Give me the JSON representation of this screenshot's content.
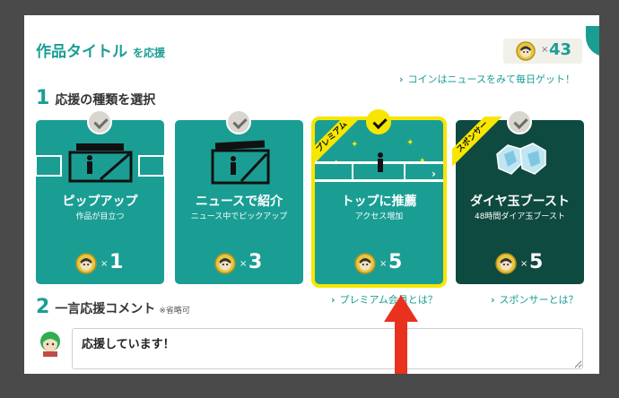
{
  "header": {
    "title": "作品タイトル",
    "subtitle": "を応援",
    "coin_x": "×",
    "coin_count": "43"
  },
  "coin_link": "コインはニュースをみて毎日ゲット！",
  "section1": {
    "num": "1",
    "label": "応援の種類を選択"
  },
  "cards": [
    {
      "name": "ピップアップ",
      "sub": "作品が目立つ",
      "x": "×",
      "cost": "1",
      "ribbon": ""
    },
    {
      "name": "ニュースで紹介",
      "sub": "ニュース中でピックアップ",
      "x": "×",
      "cost": "3",
      "ribbon": ""
    },
    {
      "name": "トップに推薦",
      "sub": "アクセス増加",
      "x": "×",
      "cost": "5",
      "ribbon": "プレミアム"
    },
    {
      "name": "ダイヤ玉ブースト",
      "sub": "48時間ダイア玉ブースト",
      "x": "×",
      "cost": "5",
      "ribbon": "スポンサー"
    }
  ],
  "links": {
    "premium": "プレミアム会員とは？",
    "sponsor": "スポンサーとは？"
  },
  "section2": {
    "num": "2",
    "label": "一言応援コメント",
    "note": "※省略可"
  },
  "comment": {
    "value": "応援しています！"
  },
  "colors": {
    "teal": "#1a9e94",
    "dark": "#0e4a3f",
    "yellow": "#f7e600",
    "arrow": "#e8321e"
  }
}
